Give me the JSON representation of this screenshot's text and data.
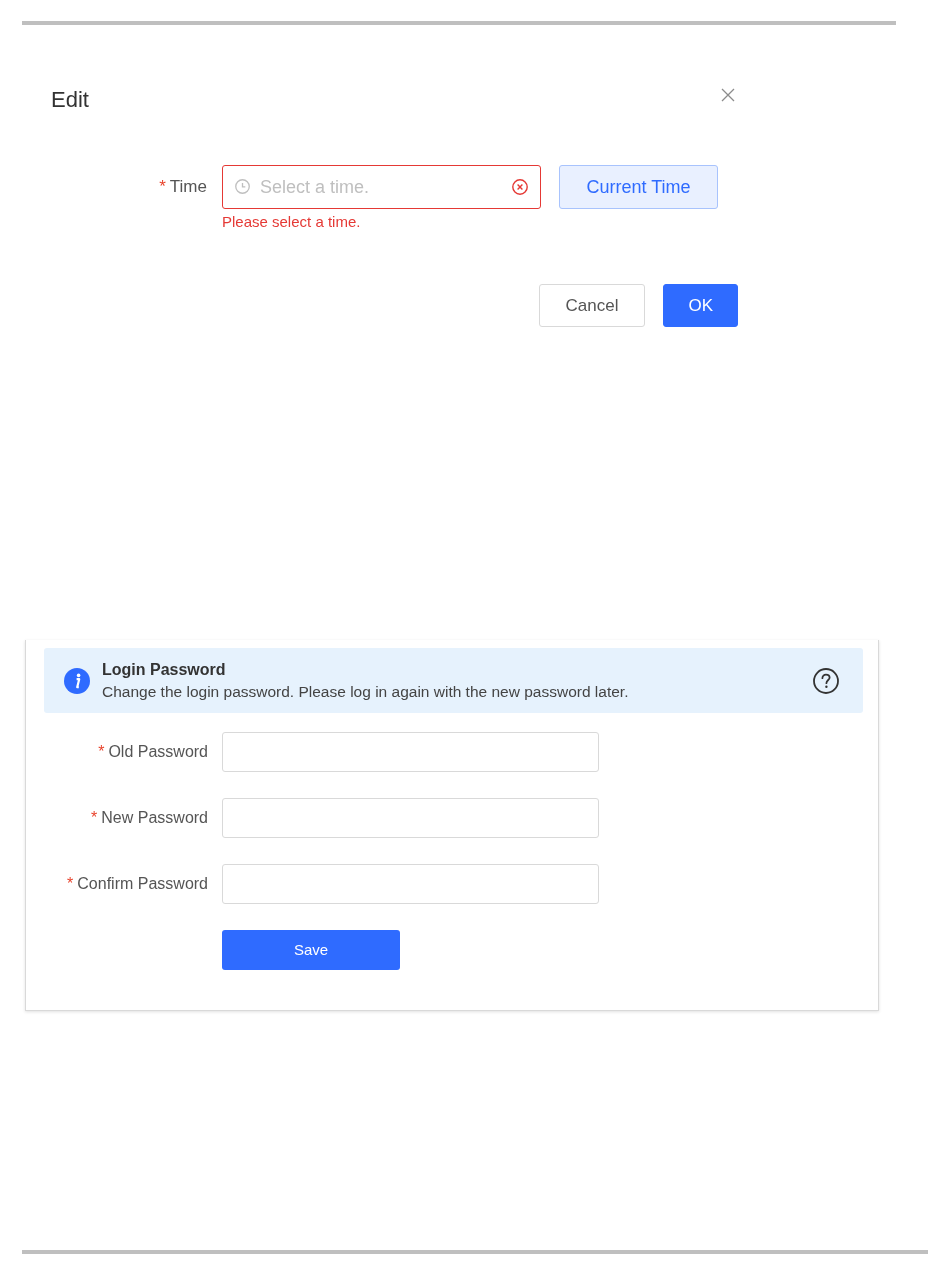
{
  "edit_dialog": {
    "title": "Edit",
    "time_field": {
      "required_mark": "*",
      "label": "Time",
      "placeholder": "Select a time.",
      "invalid": true,
      "error": "Please select a time."
    },
    "current_time_button": "Current Time",
    "buttons": [
      {
        "label": "Cancel",
        "kind": "secondary"
      },
      {
        "label": "OK",
        "kind": "primary"
      }
    ]
  },
  "login_password": {
    "notice": {
      "title": "Login Password",
      "text": "Change the login password. Please log in again with the new password later."
    },
    "fields": [
      {
        "required_mark": "*",
        "label": "Old Password"
      },
      {
        "required_mark": "*",
        "label": "New Password"
      },
      {
        "required_mark": "*",
        "label": "Confirm Password"
      }
    ],
    "save_button": "Save"
  }
}
